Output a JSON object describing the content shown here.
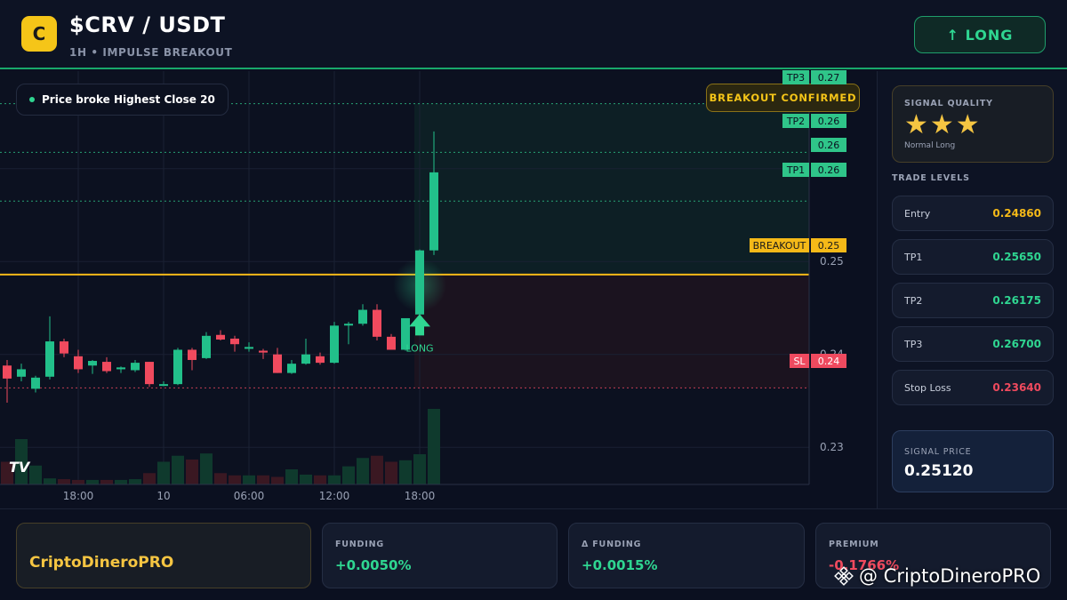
{
  "header": {
    "logo_letter": "C",
    "pair": "$CRV / USDT",
    "subtitle": "1H • IMPULSE BREAKOUT",
    "long_button": "↑ LONG"
  },
  "chart": {
    "info_pill": "Price broke Highest Close 20",
    "confirmed_badge": "BREAKOUT CONFIRMED",
    "signal_label": "LONG",
    "tv_logo": "TV",
    "level_tags": [
      {
        "name": "TP3",
        "value": "0.27"
      },
      {
        "name": "TP2",
        "value": "0.26"
      },
      {
        "name": "TP1",
        "value": "0.26"
      },
      {
        "name": "BREAKOUT",
        "value": "0.25"
      },
      {
        "name": "SL",
        "value": "0.24"
      }
    ],
    "last_price_tag": "0.26",
    "colors": {
      "up": "#22c08a",
      "down": "#f04a5e",
      "breakout": "#f5b918",
      "sl": "#ef4a5f"
    }
  },
  "chart_data": {
    "type": "candlestick",
    "y_ticks": [
      "0.26",
      "0.25",
      "0.24",
      "0.23"
    ],
    "x_ticks": [
      "18:00",
      "10",
      "06:00",
      "12:00",
      "18:00"
    ],
    "ylim": [
      0.226,
      0.2705
    ],
    "levels": {
      "tp3": 0.267,
      "tp2": 0.26175,
      "tp1": 0.2565,
      "breakout": 0.2486,
      "sl": 0.2364
    },
    "candles": [
      [
        0.2388,
        0.2394,
        0.2348,
        0.2374
      ],
      [
        0.2376,
        0.239,
        0.2371,
        0.2384
      ],
      [
        0.2363,
        0.2377,
        0.2359,
        0.2375
      ],
      [
        0.2376,
        0.2441,
        0.2373,
        0.2414
      ],
      [
        0.2414,
        0.2417,
        0.2397,
        0.2401
      ],
      [
        0.2398,
        0.2405,
        0.238,
        0.2384
      ],
      [
        0.2388,
        0.2394,
        0.2379,
        0.2393
      ],
      [
        0.2392,
        0.2397,
        0.238,
        0.2382
      ],
      [
        0.2384,
        0.2387,
        0.238,
        0.2386
      ],
      [
        0.2383,
        0.2394,
        0.2381,
        0.2391
      ],
      [
        0.2392,
        0.2392,
        0.2365,
        0.2368
      ],
      [
        0.2368,
        0.2371,
        0.2366,
        0.2368
      ],
      [
        0.2368,
        0.2407,
        0.2367,
        0.2405
      ],
      [
        0.2405,
        0.2407,
        0.2383,
        0.2394
      ],
      [
        0.2396,
        0.2424,
        0.2395,
        0.242
      ],
      [
        0.2421,
        0.2426,
        0.2415,
        0.2416
      ],
      [
        0.2417,
        0.242,
        0.2403,
        0.2411
      ],
      [
        0.2406,
        0.2413,
        0.2403,
        0.2408
      ],
      [
        0.2404,
        0.2406,
        0.2395,
        0.2402
      ],
      [
        0.24,
        0.2407,
        0.238,
        0.238
      ],
      [
        0.238,
        0.2394,
        0.2379,
        0.239
      ],
      [
        0.239,
        0.2417,
        0.2389,
        0.24
      ],
      [
        0.2398,
        0.2402,
        0.2389,
        0.2391
      ],
      [
        0.2391,
        0.2435,
        0.239,
        0.2431
      ],
      [
        0.2432,
        0.2435,
        0.2411,
        0.2433
      ],
      [
        0.2433,
        0.2454,
        0.2431,
        0.2448
      ],
      [
        0.2448,
        0.2454,
        0.2415,
        0.2419
      ],
      [
        0.2419,
        0.2422,
        0.2405,
        0.2405
      ],
      [
        0.2405,
        0.2439,
        0.2404,
        0.2439
      ],
      [
        0.2443,
        0.2513,
        0.2435,
        0.2512
      ],
      [
        0.2512,
        0.264,
        0.2507,
        0.2596
      ]
    ],
    "volume": [
      0.3,
      0.6,
      0.25,
      0.08,
      0.07,
      0.06,
      0.06,
      0.06,
      0.06,
      0.07,
      0.15,
      0.3,
      0.38,
      0.33,
      0.41,
      0.15,
      0.12,
      0.12,
      0.12,
      0.1,
      0.2,
      0.13,
      0.12,
      0.12,
      0.24,
      0.35,
      0.38,
      0.3,
      0.32,
      0.4,
      1.0
    ]
  },
  "side": {
    "quality_label": "SIGNAL QUALITY",
    "stars": "★★★",
    "quality_note": "Normal Long",
    "levels_title": "TRADE LEVELS",
    "levels": [
      {
        "name": "Entry",
        "value": "0.24860",
        "color": "#f5b918"
      },
      {
        "name": "TP1",
        "value": "0.25650",
        "color": "#2fd691"
      },
      {
        "name": "TP2",
        "value": "0.26175",
        "color": "#2fd691"
      },
      {
        "name": "TP3",
        "value": "0.26700",
        "color": "#2fd691"
      },
      {
        "name": "Stop Loss",
        "value": "0.23640",
        "color": "#f04a5e"
      }
    ],
    "signal_price_label": "SIGNAL PRICE",
    "signal_price": "0.25120"
  },
  "footer": {
    "brand": "CriptoDineroPRO",
    "cards": [
      {
        "label": "FUNDING",
        "value": "+0.0050%",
        "color": "#2fd691"
      },
      {
        "label": "Δ FUNDING",
        "value": "+0.0015%",
        "color": "#2fd691"
      },
      {
        "label": "PREMIUM",
        "value": "-0.1766%",
        "color": "#f04a5e"
      }
    ],
    "watermark": "@ CriptoDineroPRO"
  }
}
